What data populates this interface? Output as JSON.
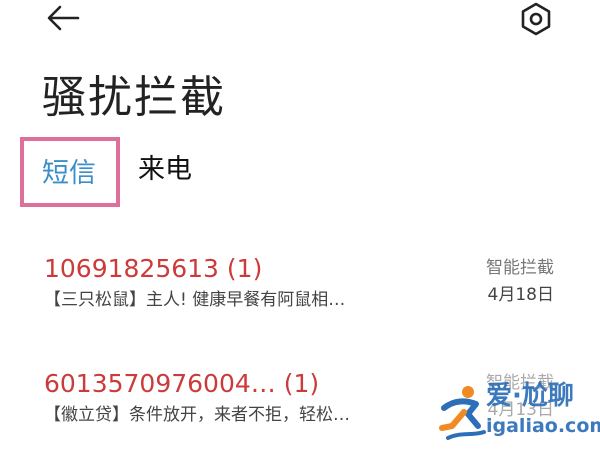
{
  "header": {
    "back_icon": "arrow-left-icon",
    "settings_icon": "settings-hexagon-icon",
    "title": "骚扰拦截"
  },
  "tabs": [
    {
      "label": "短信",
      "selected": true
    },
    {
      "label": "来电",
      "selected": false
    }
  ],
  "messages": [
    {
      "sender": "10691825613 (1)",
      "preview": "【三只松鼠】主人! 健康早餐有阿鼠相…",
      "status": "智能拦截",
      "date": "4月18日"
    },
    {
      "sender": "6013570976004… (1)",
      "preview": "【徽立贷】条件放开，来者不拒，轻松…",
      "status": "智能拦截",
      "date": "4月13日"
    }
  ],
  "watermark": {
    "cn": "爱·尬聊",
    "en": "igaliao.com"
  },
  "colors": {
    "highlight_border": "#de6f9a",
    "selected_tab": "#3b8fc9",
    "sender_red": "#cc3a3a",
    "watermark_blue": "#2c6fb8",
    "watermark_orange": "#f08a24"
  }
}
